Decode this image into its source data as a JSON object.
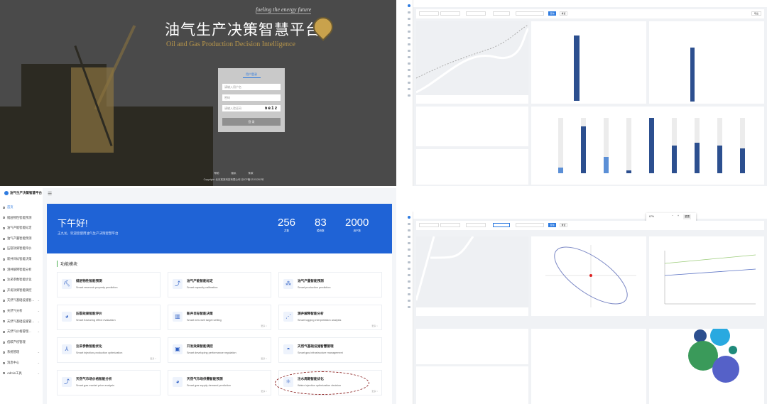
{
  "login": {
    "slogan": "fueling the energy future",
    "title": "油气生产决策智慧平台",
    "subtitle": "Oil and Gas Production Decision Intelligence",
    "tab": "用户登录",
    "username_placeholder": "请输入用户名",
    "password_placeholder": "密码",
    "captcha_placeholder": "请输入验证码",
    "captcha": "ne1z",
    "submit": "登 录",
    "footer_links": [
      "帮助",
      "隐私",
      "条款"
    ],
    "copyright": "Copyright: 北京某某科技有限公司    京ICP备12101261号"
  },
  "dash_top": {
    "filters": [
      "",
      "",
      "",
      "",
      ""
    ],
    "query": "查询",
    "reset": "重置",
    "export": "导出"
  },
  "dash_bottom": {
    "zoom": "67%",
    "minus": "−",
    "plus": "+",
    "reset_zoom": "重置",
    "query": "查询",
    "reset": "重置"
  },
  "home": {
    "brand": "油气生产决策智慧平台",
    "menu": [
      {
        "label": "首页",
        "active": true
      },
      {
        "label": "储层物性智能预测"
      },
      {
        "label": "油气产能智能标定"
      },
      {
        "label": "油气产量智能预测"
      },
      {
        "label": "压裂效果智能评价"
      },
      {
        "label": "新井目标智能决策"
      },
      {
        "label": "测井解释智能分析"
      },
      {
        "label": "注采参数智能优化"
      },
      {
        "label": "开发效果智能调控"
      },
      {
        "label": "天然气基础设施智...",
        "sub": true
      },
      {
        "label": "天然气分析",
        "sub": true
      },
      {
        "label": "天然气基础设施管...",
        "sub": true
      },
      {
        "label": "天然气价格管理...",
        "sub": true
      },
      {
        "label": "低碳产权管理"
      },
      {
        "label": "系统管理",
        "sub": true
      },
      {
        "label": "消息中心",
        "sub": true
      },
      {
        "label": "Admin工具",
        "sub": true
      }
    ],
    "greeting": "下午好!",
    "welcome": "王九龙，欢迎您使用油气生产决策智慧平台",
    "stats": [
      {
        "value": "256",
        "label": "井数"
      },
      {
        "value": "83",
        "label": "模块数"
      },
      {
        "value": "2000",
        "label": "用户数"
      }
    ],
    "section": "功能模块",
    "more": "更多 >",
    "modules": [
      {
        "zh": "储层物性智能预测",
        "en": "Smart reservoir property prediction",
        "icon": "rig-icon",
        "more": false
      },
      {
        "zh": "油气产能智能标定",
        "en": "Smart capacity calibration",
        "icon": "pipe-icon",
        "more": false
      },
      {
        "zh": "油气产量智能预测",
        "en": "Smart production prediction",
        "icon": "stack-icon",
        "more": false
      },
      {
        "zh": "压裂效果智能评价",
        "en": "Smart fracturing effect evaluation",
        "icon": "pie-icon",
        "more": false
      },
      {
        "zh": "新井目标智能决策",
        "en": "Smart new well target setting",
        "icon": "bar-chart-icon",
        "more": true
      },
      {
        "zh": "测井解释智能分析",
        "en": "Smart logging interpretation analysis",
        "icon": "scatter-icon",
        "more": true
      },
      {
        "zh": "注采参数智能优化",
        "en": "Smart injection-production optimization",
        "icon": "network-icon",
        "more": true
      },
      {
        "zh": "开发效果智能调控",
        "en": "Smart developing performance regulation",
        "icon": "chart-box-icon",
        "more": true
      },
      {
        "zh": "天然气基础设施智慧管理",
        "en": "Smart gas infrastructure management",
        "icon": "gauge-icon",
        "more": false
      },
      {
        "zh": "天然气市场价格智能分析",
        "en": "Smart gas market price analysis",
        "icon": "pipe-icon",
        "more": false
      },
      {
        "zh": "天然气市场供需智能预测",
        "en": "Smart gas supply-demand prediction",
        "icon": "pie-icon",
        "more": true
      },
      {
        "zh": "注水周期智能优化",
        "en": "Water injection optimization decision",
        "icon": "atom-icon",
        "more": true
      }
    ]
  },
  "colors": {
    "primary": "#2e7be0",
    "banner": "#1f63d6",
    "bar": "#2c4f8f",
    "gold": "#b8964a"
  },
  "charts": {
    "top_bars": [
      0.1,
      0.85,
      0.3,
      0.05,
      1.0,
      0.5,
      0.55,
      0.5,
      0.45
    ],
    "bubbles": [
      {
        "color": "#2c4f8f"
      },
      {
        "color": "#29a9e0"
      },
      {
        "color": "#1f8a7a"
      },
      {
        "color": "#3a9a5a"
      },
      {
        "color": "#5561c8"
      }
    ]
  }
}
